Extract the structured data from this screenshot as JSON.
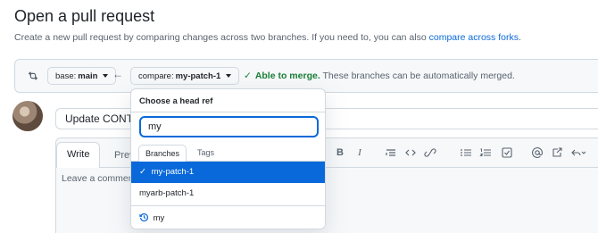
{
  "header": {
    "title": "Open a pull request",
    "subtitle_text": "Create a new pull request by comparing changes across two branches. If you need to, you can also",
    "subtitle_link": "compare across forks",
    "subtitle_end": "."
  },
  "compare_bar": {
    "base_prefix": "base:",
    "base_branch": "main",
    "compare_prefix": "compare:",
    "compare_branch": "my-patch-1",
    "merge_ok": "Able to merge.",
    "merge_message": "These branches can be automatically merged."
  },
  "pr_form": {
    "title_value": "Update CONT",
    "tabs": {
      "write": "Write",
      "preview": "Prev"
    },
    "body_placeholder": "Leave a commer"
  },
  "toolbar": {
    "bold": "B",
    "italic": "I"
  },
  "branch_dropdown": {
    "header": "Choose a head ref",
    "filter_value": "my",
    "tabs": {
      "branches": "Branches",
      "tags": "Tags"
    },
    "items": [
      {
        "label": "my-patch-1",
        "selected": true
      },
      {
        "label": "myarb-patch-1",
        "selected": false
      }
    ],
    "history_item": "my"
  },
  "colors": {
    "accent": "#0969da",
    "success": "#1a7f37",
    "border": "#d1d9e0",
    "muted": "#59636e"
  }
}
